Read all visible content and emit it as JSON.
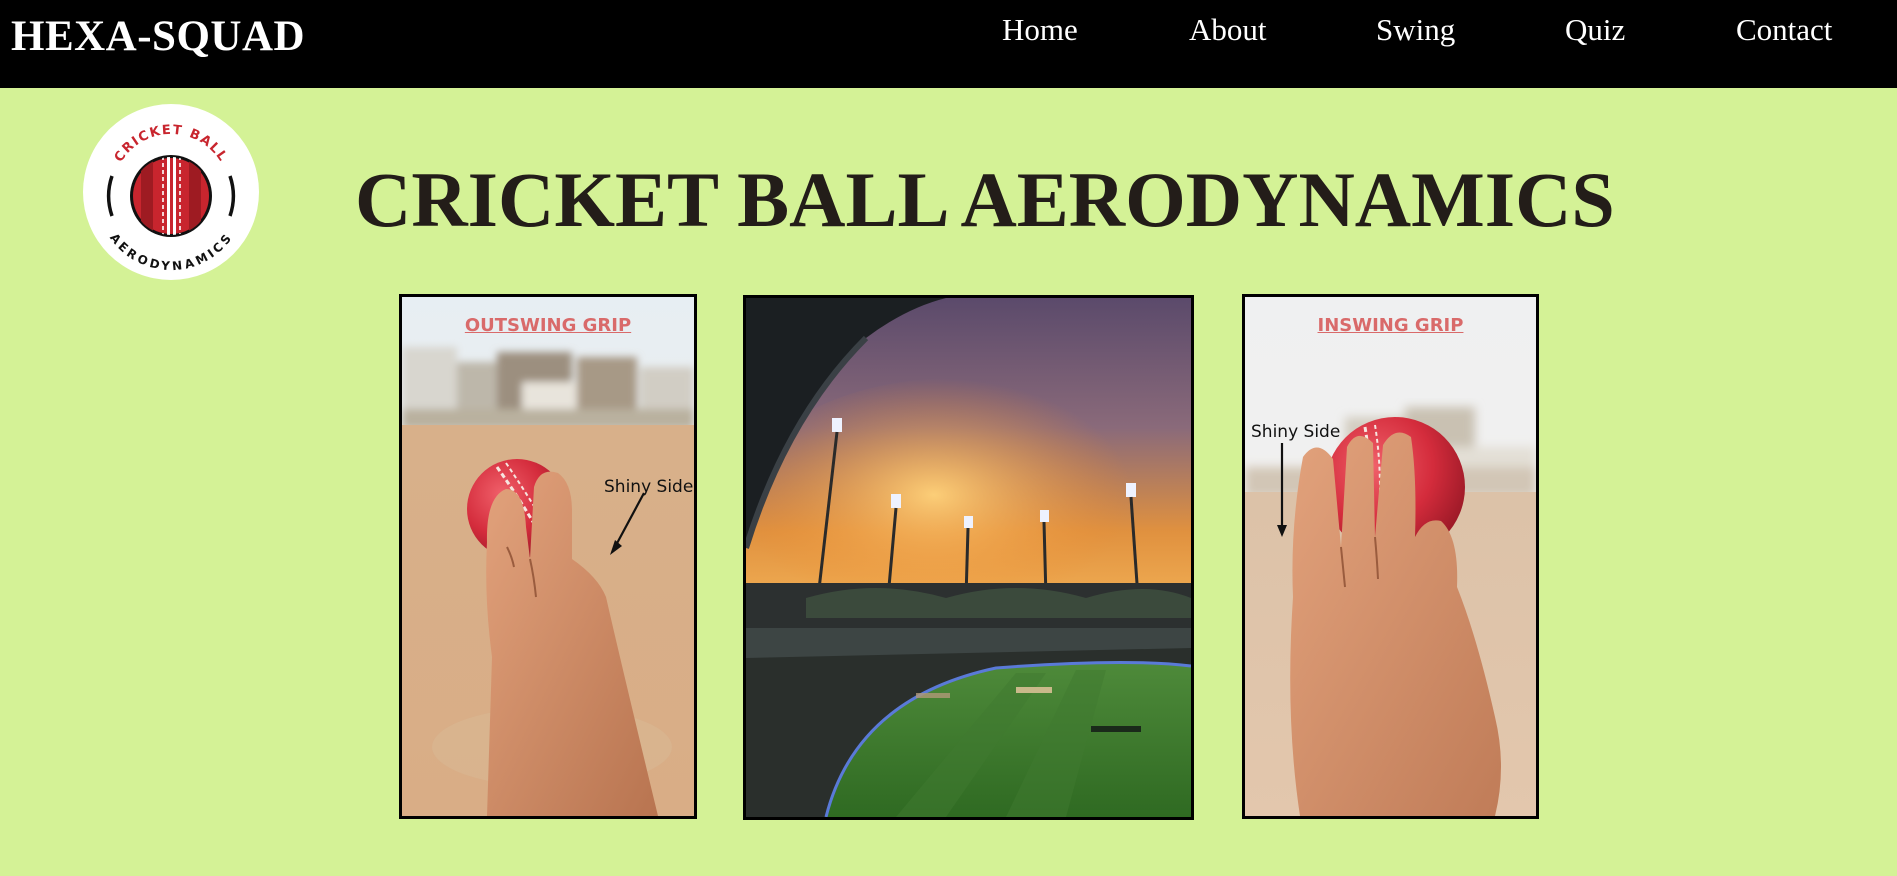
{
  "header": {
    "brand": "HEXA-SQUAD",
    "nav": [
      {
        "label": "Home"
      },
      {
        "label": "About"
      },
      {
        "label": "Swing"
      },
      {
        "label": "Quiz"
      },
      {
        "label": "Contact"
      }
    ]
  },
  "logo": {
    "top_text": "CRICKET BALL",
    "bottom_text": "AERODYNAMICS",
    "icon": "cricket-ball-icon"
  },
  "main": {
    "title": "CRICKET BALL AERODYNAMICS",
    "cards": [
      {
        "title": "OUTSWING GRIP",
        "annotation": "Shiny Side",
        "image": "hand-gripping-ball-photo"
      },
      {
        "image": "cricket-stadium-sunset-photo"
      },
      {
        "title": "INSWING GRIP",
        "annotation": "Shiny Side",
        "image": "hand-gripping-ball-photo"
      }
    ]
  },
  "colors": {
    "page_background": "#d4f296",
    "navbar": "#000000",
    "grip_title": "#d96a6a",
    "ball_red": "#c8252e"
  }
}
